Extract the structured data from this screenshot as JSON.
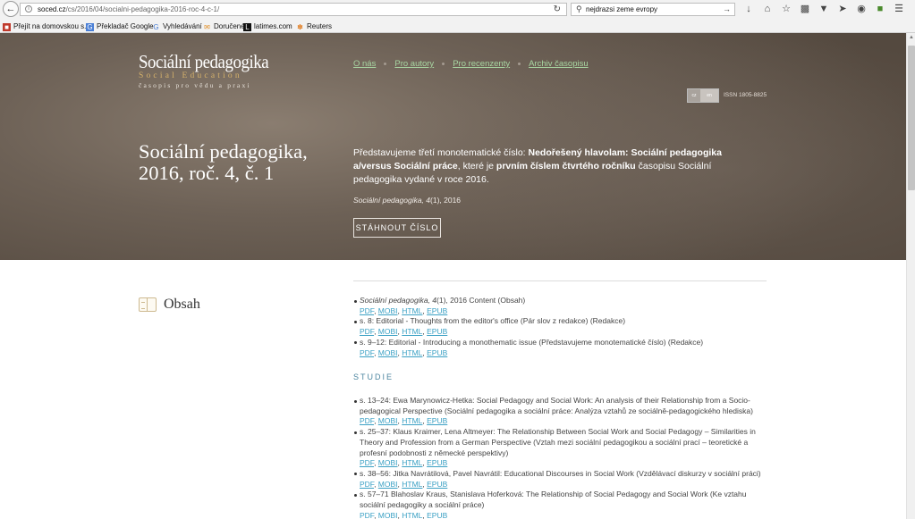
{
  "browser": {
    "url_host": "soced.cz",
    "url_path": "/cs/2016/04/socialni-pedagogika-2016-roc-4-c-1/",
    "search_value": "nejdrazsi zeme evropy",
    "bookmarks": [
      {
        "label": "Přejít na domovskou s...",
        "icon": "red-square"
      },
      {
        "label": "Překladač Google",
        "icon": "google-translate"
      },
      {
        "label": "Vyhledávání",
        "icon": "google"
      },
      {
        "label": "Doručené",
        "icon": "mail"
      },
      {
        "label": "latimes.com",
        "icon": "latimes"
      },
      {
        "label": "Reuters",
        "icon": "reuters"
      }
    ]
  },
  "site": {
    "logo_main": "Sociální pedagogika",
    "logo_sub": "Social Education",
    "logo_tag": "časopis pro vědu a praxi",
    "nav": [
      "O nás",
      "Pro autory",
      "Pro recenzenty",
      "Archiv časopisu"
    ],
    "lang_cz": "cz",
    "lang_en": "en",
    "issn": "ISSN 1805-8825"
  },
  "hero": {
    "title": "Sociální pedagogika, 2016, roč. 4, č. 1",
    "desc_1": "Představujeme třetí monotematické číslo: ",
    "desc_2": "Nedořešený hlavolam: Sociální pedagogika a/versus Sociální práce",
    "desc_3": ", které je ",
    "desc_4": "prvním číslem čtvrtého ročníku",
    "desc_5": " časopisu Sociální pedagogika vydané v roce 2016.",
    "cite_italic": "Sociální pedagogika, 4",
    "cite_rest": "(1), 2016",
    "download": "STÁHNOUT ČÍSLO"
  },
  "content": {
    "obsah": "Obsah",
    "studie": "STUDIE",
    "formats": [
      "PDF",
      "MOBI",
      "HTML",
      "EPUB"
    ],
    "top_items": [
      {
        "italic": "Sociální pedagogika, 4",
        "text": "(1), 2016 Content (Obsah)"
      },
      {
        "italic": "",
        "text": "s. 8: Editorial - Thoughts from the editor's office (Pár slov z redakce) (Redakce)"
      },
      {
        "italic": "",
        "text": "s. 9–12: Editorial - Introducing a monothematic issue (Představujeme monotematické číslo) (Redakce)"
      }
    ],
    "studie_items": [
      {
        "text": "s. 13–24: Ewa Marynowicz-Hetka: Social Pedagogy and Social Work: An analysis of their Relationship from a Socio-pedagogical Perspective (Sociální pedagogika a sociální práce: Analýza vztahů ze sociálně-pedagogického hlediska)"
      },
      {
        "text": "s. 25–37: Klaus Kraimer, Lena Altmeyer: The Relationship Between Social Work and Social Pedagogy – Similarities in Theory and Profession from a German Perspective (Vztah mezi sociální pedagogikou a sociální prací – teoretické a profesní podobnosti z německé perspektivy)"
      },
      {
        "text": "s. 38–56: Jitka Navrátilová, Pavel Navrátil: Educational Discourses in Social Work (Vzdělávací diskurzy v sociální práci)"
      },
      {
        "text": "s. 57–71 Blahoslav Kraus, Stanislava Hoferková: The Relationship of Social Pedagogy and Social Work (Ke vztahu sociální pedagogiky a sociální práce)"
      }
    ]
  }
}
